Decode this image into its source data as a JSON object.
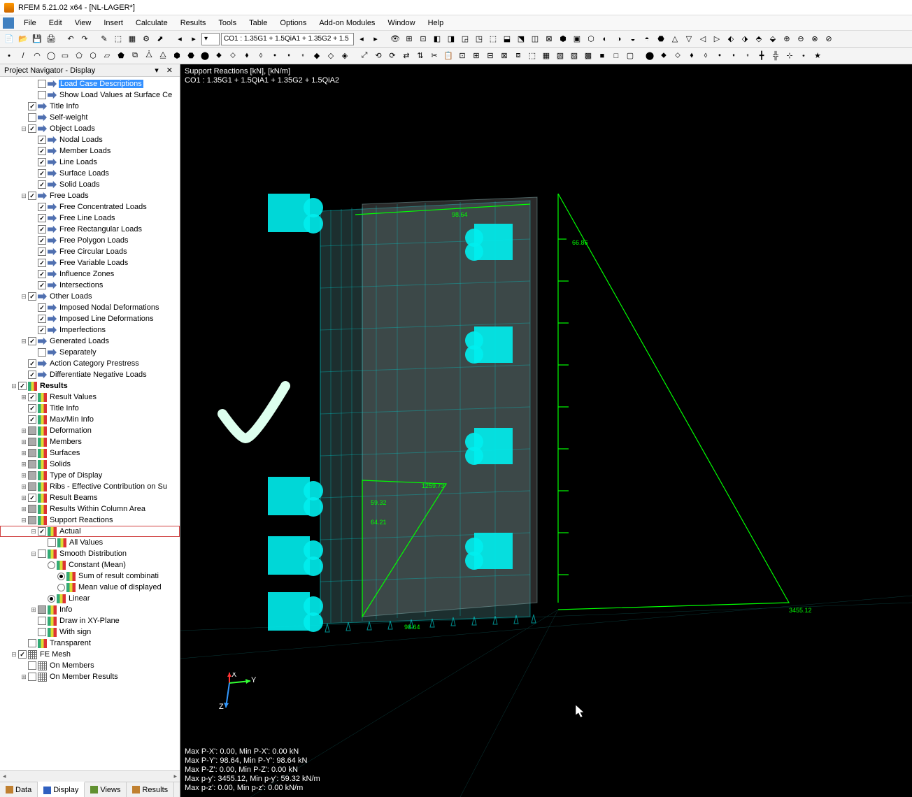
{
  "window": {
    "title": "RFEM 5.21.02 x64 - [NL-LAGER*]"
  },
  "menus": [
    "File",
    "Edit",
    "View",
    "Insert",
    "Calculate",
    "Results",
    "Tools",
    "Table",
    "Options",
    "Add-on Modules",
    "Window",
    "Help"
  ],
  "panel": {
    "title": "Project Navigator - Display",
    "tabs": [
      {
        "icon": "#c08030",
        "label": "Data"
      },
      {
        "icon": "#3060c0",
        "label": "Display"
      },
      {
        "icon": "#609030",
        "label": "Views"
      },
      {
        "icon": "#c08030",
        "label": "Results"
      }
    ]
  },
  "combo": {
    "co_label": "CO1 : 1.35G1 + 1.5QiA1 + 1.35G2 + 1.5"
  },
  "tree": [
    {
      "d": 3,
      "exp": " ",
      "chk": "u",
      "ic": "arrow",
      "t": "Load Case Descriptions",
      "sel": true
    },
    {
      "d": 3,
      "exp": " ",
      "chk": "u",
      "ic": "arrow",
      "t": "Show Load Values at Surface Ce"
    },
    {
      "d": 2,
      "exp": " ",
      "chk": "c",
      "ic": "arrow",
      "t": "Title Info"
    },
    {
      "d": 2,
      "exp": " ",
      "chk": "u",
      "ic": "arrow",
      "t": "Self-weight"
    },
    {
      "d": 2,
      "exp": "-",
      "chk": "c",
      "ic": "arrow",
      "t": "Object Loads"
    },
    {
      "d": 3,
      "exp": " ",
      "chk": "c",
      "ic": "arrow",
      "t": "Nodal Loads"
    },
    {
      "d": 3,
      "exp": " ",
      "chk": "c",
      "ic": "arrow",
      "t": "Member Loads"
    },
    {
      "d": 3,
      "exp": " ",
      "chk": "c",
      "ic": "arrow",
      "t": "Line Loads"
    },
    {
      "d": 3,
      "exp": " ",
      "chk": "c",
      "ic": "arrow",
      "t": "Surface Loads"
    },
    {
      "d": 3,
      "exp": " ",
      "chk": "c",
      "ic": "arrow",
      "t": "Solid Loads"
    },
    {
      "d": 2,
      "exp": "-",
      "chk": "c",
      "ic": "arrow",
      "t": "Free Loads"
    },
    {
      "d": 3,
      "exp": " ",
      "chk": "c",
      "ic": "arrow",
      "t": "Free Concentrated Loads"
    },
    {
      "d": 3,
      "exp": " ",
      "chk": "c",
      "ic": "arrow",
      "t": "Free Line Loads"
    },
    {
      "d": 3,
      "exp": " ",
      "chk": "c",
      "ic": "arrow",
      "t": "Free Rectangular Loads"
    },
    {
      "d": 3,
      "exp": " ",
      "chk": "c",
      "ic": "arrow",
      "t": "Free Polygon Loads"
    },
    {
      "d": 3,
      "exp": " ",
      "chk": "c",
      "ic": "arrow",
      "t": "Free Circular Loads"
    },
    {
      "d": 3,
      "exp": " ",
      "chk": "c",
      "ic": "arrow",
      "t": "Free Variable Loads"
    },
    {
      "d": 3,
      "exp": " ",
      "chk": "c",
      "ic": "arrow",
      "t": "Influence Zones"
    },
    {
      "d": 3,
      "exp": " ",
      "chk": "c",
      "ic": "arrow",
      "t": "Intersections"
    },
    {
      "d": 2,
      "exp": "-",
      "chk": "c",
      "ic": "arrow",
      "t": "Other Loads"
    },
    {
      "d": 3,
      "exp": " ",
      "chk": "c",
      "ic": "arrow",
      "t": "Imposed Nodal Deformations"
    },
    {
      "d": 3,
      "exp": " ",
      "chk": "c",
      "ic": "arrow",
      "t": "Imposed Line Deformations"
    },
    {
      "d": 3,
      "exp": " ",
      "chk": "c",
      "ic": "arrow",
      "t": "Imperfections"
    },
    {
      "d": 2,
      "exp": "-",
      "chk": "c",
      "ic": "arrow",
      "t": "Generated Loads"
    },
    {
      "d": 3,
      "exp": " ",
      "chk": "u",
      "ic": "arrow",
      "t": "Separately"
    },
    {
      "d": 2,
      "exp": " ",
      "chk": "c",
      "ic": "arrow",
      "t": "Action Category Prestress"
    },
    {
      "d": 2,
      "exp": " ",
      "chk": "c",
      "ic": "arrow",
      "t": "Differentiate Negative Loads"
    },
    {
      "d": 1,
      "exp": "-",
      "chk": "c",
      "ic": "result",
      "t": "Results",
      "bold": true
    },
    {
      "d": 2,
      "exp": "+",
      "chk": "c",
      "ic": "result",
      "t": "Result Values"
    },
    {
      "d": 2,
      "exp": " ",
      "chk": "c",
      "ic": "result",
      "t": "Title Info"
    },
    {
      "d": 2,
      "exp": " ",
      "chk": "c",
      "ic": "result",
      "t": "Max/Min Info"
    },
    {
      "d": 2,
      "exp": "+",
      "chk": "f",
      "ic": "result",
      "t": "Deformation"
    },
    {
      "d": 2,
      "exp": "+",
      "chk": "f",
      "ic": "result",
      "t": "Members"
    },
    {
      "d": 2,
      "exp": "+",
      "chk": "f",
      "ic": "result",
      "t": "Surfaces"
    },
    {
      "d": 2,
      "exp": "+",
      "chk": "f",
      "ic": "result",
      "t": "Solids"
    },
    {
      "d": 2,
      "exp": "+",
      "chk": "f",
      "ic": "result",
      "t": "Type of Display"
    },
    {
      "d": 2,
      "exp": "+",
      "chk": "f",
      "ic": "result",
      "t": "Ribs - Effective Contribution on Su"
    },
    {
      "d": 2,
      "exp": "+",
      "chk": "c",
      "ic": "result",
      "t": "Result Beams"
    },
    {
      "d": 2,
      "exp": "+",
      "chk": "f",
      "ic": "result",
      "t": "Results Within Column Area"
    },
    {
      "d": 2,
      "exp": "-",
      "chk": "f",
      "ic": "result",
      "t": "Support Reactions"
    },
    {
      "d": 3,
      "exp": "-",
      "chk": "c",
      "ic": "result",
      "t": "Actual",
      "hl": true
    },
    {
      "d": 4,
      "exp": " ",
      "chk": "u",
      "ic": "result",
      "t": "All Values"
    },
    {
      "d": 3,
      "exp": "-",
      "chk": "u",
      "ic": "result",
      "t": "Smooth Distribution"
    },
    {
      "d": 4,
      "exp": " ",
      "rad": "off",
      "ic": "result",
      "t": "Constant (Mean)"
    },
    {
      "d": 5,
      "exp": " ",
      "rad": "on",
      "ic": "result",
      "t": "Sum of result combinati"
    },
    {
      "d": 5,
      "exp": " ",
      "rad": "off",
      "ic": "result",
      "t": "Mean value of displayed"
    },
    {
      "d": 4,
      "exp": " ",
      "rad": "on",
      "ic": "result",
      "t": "Linear"
    },
    {
      "d": 3,
      "exp": "+",
      "chk": "f",
      "ic": "result",
      "t": "Info"
    },
    {
      "d": 3,
      "exp": " ",
      "chk": "u",
      "ic": "result",
      "t": "Draw in XY-Plane"
    },
    {
      "d": 3,
      "exp": " ",
      "chk": "u",
      "ic": "result",
      "t": "With sign"
    },
    {
      "d": 2,
      "exp": " ",
      "chk": "u",
      "ic": "result",
      "t": "Transparent"
    },
    {
      "d": 1,
      "exp": "-",
      "chk": "c",
      "ic": "mesh",
      "t": "FE Mesh"
    },
    {
      "d": 2,
      "exp": " ",
      "chk": "u",
      "ic": "mesh",
      "t": "On Members"
    },
    {
      "d": 2,
      "exp": "+",
      "chk": "u",
      "ic": "mesh",
      "t": "On Member Results"
    }
  ],
  "viewport": {
    "header": [
      "Support Reactions [kN], [kN/m]",
      "CO1 : 1.35G1 + 1.5QiA1 + 1.35G2 + 1.5QiA2"
    ],
    "footer": [
      "Max P-X': 0.00, Min P-X': 0.00 kN",
      "Max P-Y': 98.64, Min P-Y': 98.64 kN",
      "Max P-Z': 0.00, Min P-Z': 0.00 kN",
      "Max p-y': 3455.12, Min p-y': 59.32 kN/m",
      "Max p-z': 0.00, Min p-z': 0.00 kN/m"
    ],
    "values": {
      "a": "98.64",
      "b": "66.86",
      "c": "1259.73",
      "d": "59.32",
      "e": "64.21",
      "f": "98.64",
      "g": "3455.12"
    },
    "axes": {
      "x": "X",
      "y": "Y",
      "z": "Z"
    }
  }
}
